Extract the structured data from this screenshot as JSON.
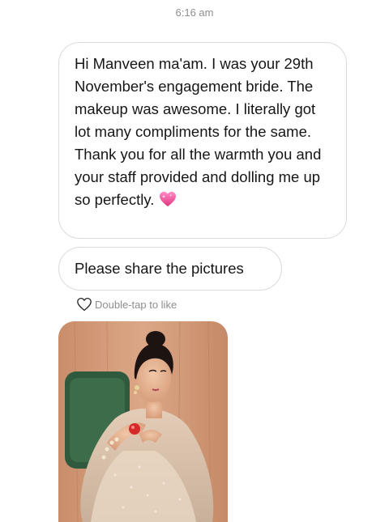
{
  "status": {
    "time": "6:16 am"
  },
  "messages": [
    {
      "text": "Hi Manveen ma'am. I was your 29th November's engagement bride. The makeup was awesome. I literally got lot many compliments for the same. Thank you for all the warmth you and your staff provided and dolling me up so perfectly.",
      "emoji": "sparkling-heart"
    },
    {
      "text": "Please share the pictures"
    }
  ],
  "like_prompt": {
    "icon": "heart-outline-icon",
    "label": "Double-tap to like"
  },
  "photo": {
    "icon": "bride-photo"
  },
  "colors": {
    "timestamp": "#8e8e8e",
    "bubble_border": "#dbdbdb",
    "heart_pink": "#ec4f9a"
  }
}
